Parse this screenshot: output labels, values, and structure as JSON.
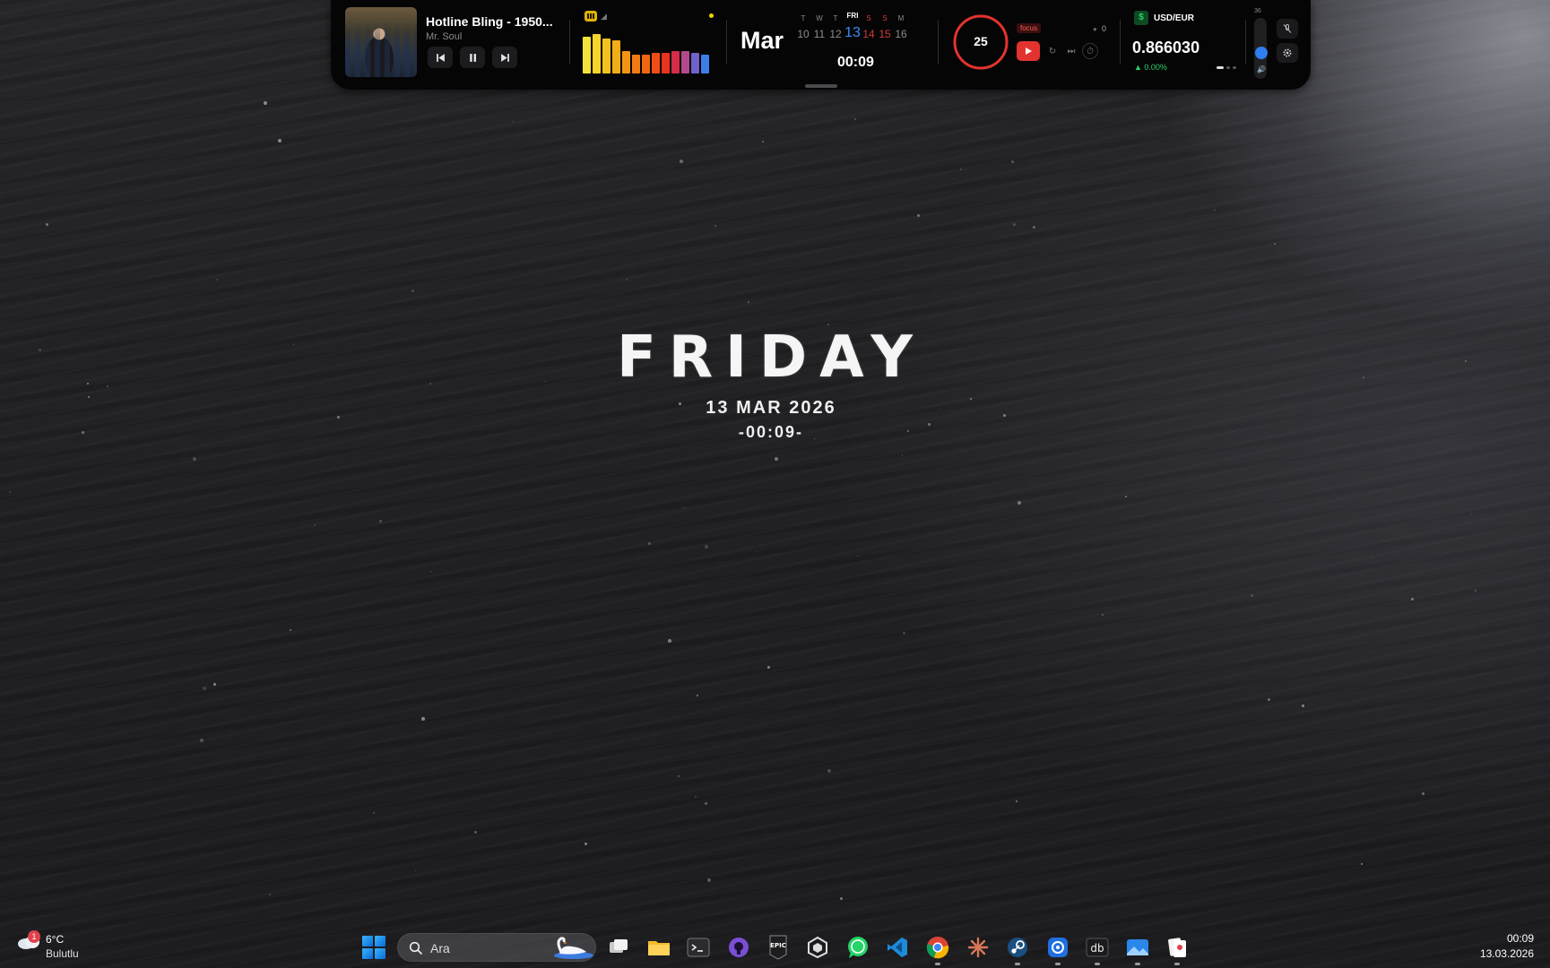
{
  "media": {
    "title": "Hotline Bling - 1950...",
    "artist": "Mr. Soul",
    "album_art_icon": "album-cover-image",
    "visualizer_levels": [
      0.9,
      0.95,
      0.85,
      0.8,
      0.55,
      0.45,
      0.45,
      0.5,
      0.5,
      0.55,
      0.55,
      0.5,
      0.45
    ],
    "visualizer_colors": [
      "#f2e33a",
      "#f5d52b",
      "#f3c41f",
      "#f2ae18",
      "#f39413",
      "#f27a12",
      "#f26512",
      "#f04d16",
      "#e8331e",
      "#d42c4a",
      "#b14a8c",
      "#6f63c9",
      "#3c7fe8"
    ]
  },
  "calendar": {
    "month": "Mar",
    "days": [
      {
        "dow": "T",
        "num": "10",
        "today": false,
        "weekend": false
      },
      {
        "dow": "W",
        "num": "11",
        "today": false,
        "weekend": false
      },
      {
        "dow": "T",
        "num": "12",
        "today": false,
        "weekend": false
      },
      {
        "dow": "FRI",
        "num": "13",
        "today": true,
        "weekend": false
      },
      {
        "dow": "S",
        "num": "14",
        "today": false,
        "weekend": true
      },
      {
        "dow": "S",
        "num": "15",
        "today": false,
        "weekend": true
      },
      {
        "dow": "M",
        "num": "16",
        "today": false,
        "weekend": false
      }
    ],
    "time": "00:09"
  },
  "pomodoro": {
    "minutes": "25",
    "mode": "focus",
    "count": "0",
    "accent": "#e3332e"
  },
  "currency": {
    "symbol": "$",
    "pair": "USD/EUR",
    "rate": "0.866030",
    "change": "▲ 0.00%",
    "up_color": "#2bd36b"
  },
  "volume": {
    "level_label": "36",
    "level": 0.36,
    "accent": "#2f7ef0"
  },
  "desktop_clock": {
    "day": "FRIDAY",
    "date": "13 MAR 2026",
    "time": "-00:09-"
  },
  "taskbar": {
    "weather_temp": "6°C",
    "weather_desc": "Bulutlu",
    "weather_badge": "1",
    "search_placeholder": "Ara",
    "apps": [
      "task-view",
      "file-explorer",
      "terminal",
      "github-desktop",
      "epic-games",
      "unity-hub",
      "whatsapp",
      "vs-code",
      "chrome",
      "claude",
      "steam",
      "app-blue",
      "dbeaver",
      "photos",
      "solitaire"
    ],
    "clock_time": "00:09",
    "clock_date": "13.03.2026"
  }
}
